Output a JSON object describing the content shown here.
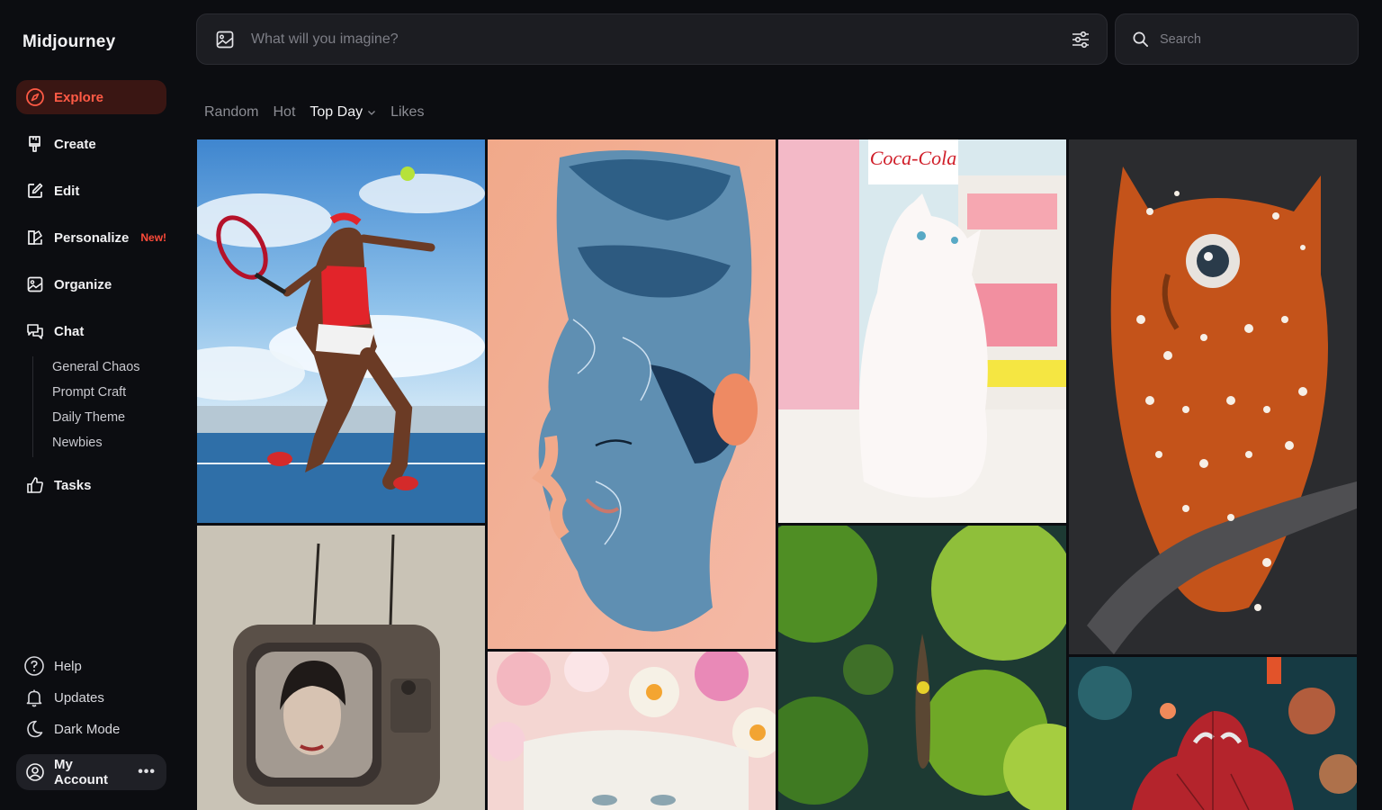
{
  "brand": "Midjourney",
  "sidebar": {
    "items": [
      {
        "label": "Explore",
        "icon": "compass-icon",
        "active": true
      },
      {
        "label": "Create",
        "icon": "brush-icon"
      },
      {
        "label": "Edit",
        "icon": "edit-icon"
      },
      {
        "label": "Personalize",
        "icon": "personalize-icon",
        "badge": "New!"
      },
      {
        "label": "Organize",
        "icon": "image-icon"
      },
      {
        "label": "Chat",
        "icon": "chat-icon"
      },
      {
        "label": "Tasks",
        "icon": "thumbs-up-icon"
      }
    ],
    "chat_channels": [
      "General Chaos",
      "Prompt Craft",
      "Daily Theme",
      "Newbies"
    ],
    "bottom": [
      {
        "label": "Help",
        "icon": "help-icon"
      },
      {
        "label": "Updates",
        "icon": "bell-icon"
      },
      {
        "label": "Dark Mode",
        "icon": "moon-icon"
      }
    ],
    "account": {
      "label": "My Account",
      "more": "•••"
    }
  },
  "imagine": {
    "placeholder": "What will you imagine?"
  },
  "search": {
    "placeholder": "Search"
  },
  "filters": {
    "tabs": [
      "Random",
      "Hot",
      "Top Day",
      "Likes"
    ],
    "active": "Top Day"
  },
  "gallery": [
    {
      "subject": "tennis player serving under blue sky"
    },
    {
      "subject": "retro television with portrait of a woman"
    },
    {
      "subject": "woman's face dissolving into water, pastel pink"
    },
    {
      "subject": "white fluffy kitten in a shop with Coca-Cola sign",
      "sign_text": "Coca-Cola"
    },
    {
      "subject": "aerial view of a canoe through green algae"
    },
    {
      "subject": "orange owl with white spots on a branch"
    },
    {
      "subject": "flower crown on a girl with white hair"
    },
    {
      "subject": "Spider-Man with bokeh lights"
    }
  ],
  "colors": {
    "background": "#0c0d11",
    "accent": "#ff5a45",
    "active_bg": "#3a1613",
    "panel": "#1c1d22"
  }
}
